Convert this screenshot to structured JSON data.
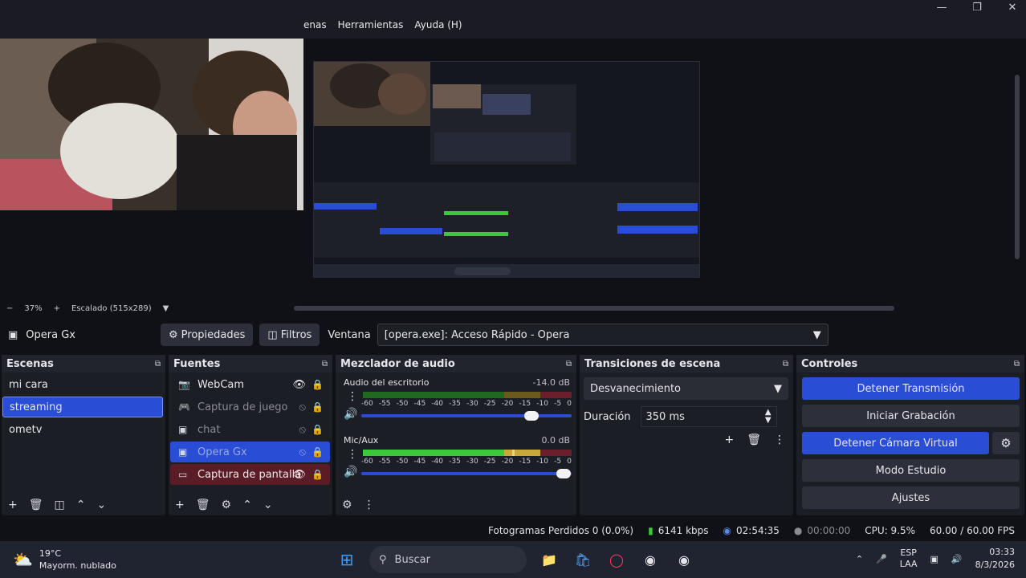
{
  "menu": [
    "enas",
    "Herramientas",
    "Ayuda (H)"
  ],
  "window_controls": [
    "minimize-icon",
    "maximize-icon",
    "close-icon"
  ],
  "zoom": {
    "percent": "37%",
    "scale_label": "Escalado (515x289)"
  },
  "source_toolbar": {
    "source_name": "Opera Gx",
    "properties_label": "Propiedades",
    "filters_label": "Filtros",
    "window_label": "Ventana",
    "window_value": "[opera.exe]: Acceso Rápido - Opera"
  },
  "scenes": {
    "title": "Escenas",
    "items": [
      "mi cara",
      "streaming",
      "ometv"
    ],
    "selected": "streaming"
  },
  "sources": {
    "title": "Fuentes",
    "items": [
      {
        "name": "WebCam",
        "icon": "camera-icon",
        "visible": true
      },
      {
        "name": "Captura de juego",
        "icon": "gamepad-icon",
        "visible": false
      },
      {
        "name": "chat",
        "icon": "window-icon",
        "visible": false
      },
      {
        "name": "Opera Gx",
        "icon": "window-icon",
        "visible": false
      },
      {
        "name": "Captura de pantalla",
        "icon": "monitor-icon",
        "visible": true
      }
    ]
  },
  "mixer": {
    "title": "Mezclador de audio",
    "channels": [
      {
        "name": "Audio del escritorio",
        "db": "-14.0 dB",
        "volume": 0.81
      },
      {
        "name": "Mic/Aux",
        "db": "0.0 dB",
        "volume": 0.96
      }
    ],
    "ticks": [
      "-60",
      "-55",
      "-50",
      "-45",
      "-40",
      "-35",
      "-30",
      "-25",
      "-20",
      "-15",
      "-10",
      "-5",
      "0"
    ]
  },
  "transitions": {
    "title": "Transiciones de escena",
    "selected": "Desvanecimiento",
    "duration_label": "Duración",
    "duration_value": "350 ms"
  },
  "controls": {
    "title": "Controles",
    "stop_stream": "Detener Transmisión",
    "start_record": "Iniciar Grabación",
    "stop_virtual_cam": "Detener Cámara Virtual",
    "studio_mode": "Modo Estudio",
    "settings": "Ajustes"
  },
  "status": {
    "dropped": "Fotogramas Perdidos 0 (0.0%)",
    "bitrate": "6141 kbps",
    "stream_time": "02:54:35",
    "record_time": "00:00:00",
    "cpu": "CPU: 9.5%",
    "fps": "60.00 / 60.00 FPS"
  },
  "taskbar": {
    "temp": "19°C",
    "weather": "Mayorm. nublado",
    "search": "Buscar",
    "lang1": "ESP",
    "lang2": "LAA",
    "time": "03:33",
    "date": "8/3/2026"
  },
  "colors": {
    "accent": "#2a4dd6",
    "meter_green": "#3bc83b",
    "meter_yellow": "#c8a838",
    "meter_red": "#c83a4a"
  }
}
